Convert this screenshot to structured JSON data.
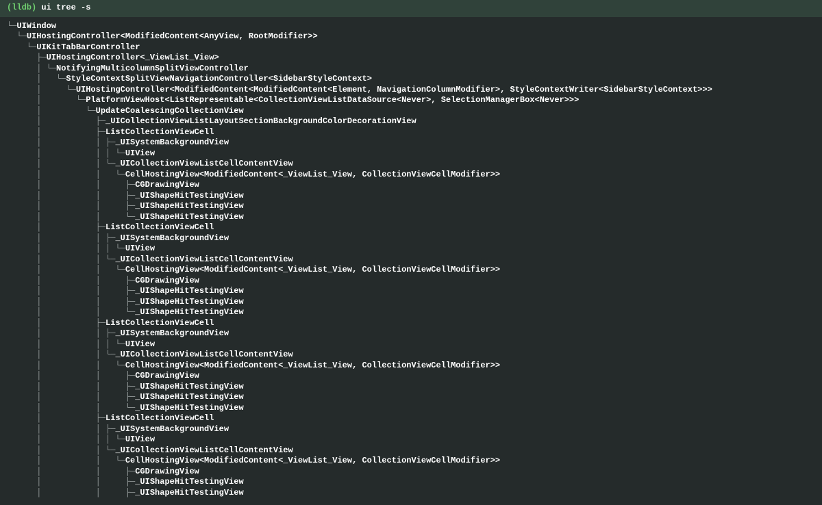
{
  "prompt": {
    "lldb": "(lldb)",
    "command": "ui tree -s"
  },
  "tree_lines": [
    {
      "prefix": "└─",
      "label": "UIWindow"
    },
    {
      "prefix": "  └─",
      "label": "UIHostingController<ModifiedContent<AnyView, RootModifier>>"
    },
    {
      "prefix": "    └─",
      "label": "UIKitTabBarController"
    },
    {
      "prefix": "      ├─",
      "label": "UIHostingController<_ViewList_View>"
    },
    {
      "prefix": "      │ └─",
      "label": "NotifyingMulticolumnSplitViewController"
    },
    {
      "prefix": "      │   └─",
      "label": "StyleContextSplitViewNavigationController<SidebarStyleContext>"
    },
    {
      "prefix": "      │     └─",
      "label": "UIHostingController<ModifiedContent<ModifiedContent<Element, NavigationColumnModifier>, StyleContextWriter<SidebarStyleContext>>>"
    },
    {
      "prefix": "      │       └─",
      "label": "PlatformViewHost<ListRepresentable<CollectionViewListDataSource<Never>, SelectionManagerBox<Never>>>"
    },
    {
      "prefix": "      │         └─",
      "label": "UpdateCoalescingCollectionView"
    },
    {
      "prefix": "      │           ├─",
      "label": "_UICollectionViewListLayoutSectionBackgroundColorDecorationView"
    },
    {
      "prefix": "      │           ├─",
      "label": "ListCollectionViewCell"
    },
    {
      "prefix": "      │           │ ├─",
      "label": "_UISystemBackgroundView"
    },
    {
      "prefix": "      │           │ │ └─",
      "label": "UIView"
    },
    {
      "prefix": "      │           │ └─",
      "label": "_UICollectionViewListCellContentView"
    },
    {
      "prefix": "      │           │   └─",
      "label": "CellHostingView<ModifiedContent<_ViewList_View, CollectionViewCellModifier>>"
    },
    {
      "prefix": "      │           │     ├─",
      "label": "CGDrawingView"
    },
    {
      "prefix": "      │           │     ├─",
      "label": "_UIShapeHitTestingView"
    },
    {
      "prefix": "      │           │     ├─",
      "label": "_UIShapeHitTestingView"
    },
    {
      "prefix": "      │           │     └─",
      "label": "_UIShapeHitTestingView"
    },
    {
      "prefix": "      │           ├─",
      "label": "ListCollectionViewCell"
    },
    {
      "prefix": "      │           │ ├─",
      "label": "_UISystemBackgroundView"
    },
    {
      "prefix": "      │           │ │ └─",
      "label": "UIView"
    },
    {
      "prefix": "      │           │ └─",
      "label": "_UICollectionViewListCellContentView"
    },
    {
      "prefix": "      │           │   └─",
      "label": "CellHostingView<ModifiedContent<_ViewList_View, CollectionViewCellModifier>>"
    },
    {
      "prefix": "      │           │     ├─",
      "label": "CGDrawingView"
    },
    {
      "prefix": "      │           │     ├─",
      "label": "_UIShapeHitTestingView"
    },
    {
      "prefix": "      │           │     ├─",
      "label": "_UIShapeHitTestingView"
    },
    {
      "prefix": "      │           │     └─",
      "label": "_UIShapeHitTestingView"
    },
    {
      "prefix": "      │           ├─",
      "label": "ListCollectionViewCell"
    },
    {
      "prefix": "      │           │ ├─",
      "label": "_UISystemBackgroundView"
    },
    {
      "prefix": "      │           │ │ └─",
      "label": "UIView"
    },
    {
      "prefix": "      │           │ └─",
      "label": "_UICollectionViewListCellContentView"
    },
    {
      "prefix": "      │           │   └─",
      "label": "CellHostingView<ModifiedContent<_ViewList_View, CollectionViewCellModifier>>"
    },
    {
      "prefix": "      │           │     ├─",
      "label": "CGDrawingView"
    },
    {
      "prefix": "      │           │     ├─",
      "label": "_UIShapeHitTestingView"
    },
    {
      "prefix": "      │           │     ├─",
      "label": "_UIShapeHitTestingView"
    },
    {
      "prefix": "      │           │     └─",
      "label": "_UIShapeHitTestingView"
    },
    {
      "prefix": "      │           ├─",
      "label": "ListCollectionViewCell"
    },
    {
      "prefix": "      │           │ ├─",
      "label": "_UISystemBackgroundView"
    },
    {
      "prefix": "      │           │ │ └─",
      "label": "UIView"
    },
    {
      "prefix": "      │           │ └─",
      "label": "_UICollectionViewListCellContentView"
    },
    {
      "prefix": "      │           │   └─",
      "label": "CellHostingView<ModifiedContent<_ViewList_View, CollectionViewCellModifier>>"
    },
    {
      "prefix": "      │           │     ├─",
      "label": "CGDrawingView"
    },
    {
      "prefix": "      │           │     ├─",
      "label": "_UIShapeHitTestingView"
    },
    {
      "prefix": "      │           │     ├─",
      "label": "_UIShapeHitTestingView"
    }
  ]
}
